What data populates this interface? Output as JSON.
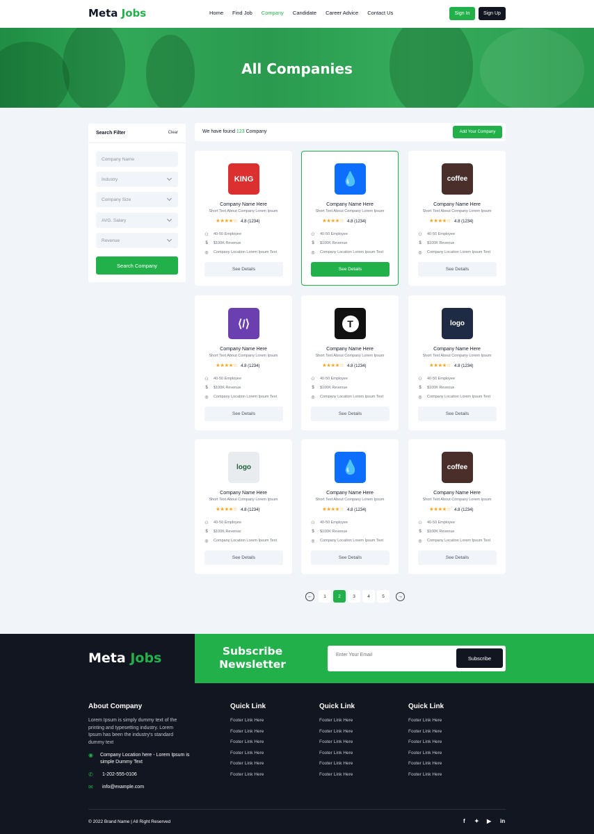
{
  "brand": {
    "part1": "Meta",
    "part2": "Jobs"
  },
  "nav": {
    "items": [
      "Home",
      "Find Job",
      "Company",
      "Candidate",
      "Career Advice",
      "Contact Us"
    ],
    "active": "Company",
    "sign_in": "Sign In",
    "sign_up": "Sign Up"
  },
  "hero": {
    "title": "All Companies"
  },
  "filter": {
    "title": "Search Filter",
    "clear": "Clear",
    "company_name_placeholder": "Company Name",
    "industry": "Industry",
    "company_size": "Company Size",
    "avg_salary": "AVG. Salary",
    "revenue": "Revenue",
    "search_button": "Search Company"
  },
  "results": {
    "prefix": "We have found",
    "count": "123",
    "suffix": "Company",
    "add_button": "Add Your Company"
  },
  "cards": [
    {
      "name": "Company Name Here",
      "short": "Short Text About Company Lorem Ipsum",
      "rating": "4.8 (1234)",
      "stars": 4,
      "employees": "40-50 Employee",
      "revenue": "$100K Revenue",
      "location": "Company Location Lorem Ipsum Text",
      "button": "See Details",
      "logo": "king-logo",
      "logo_text": "KING",
      "color": "#dc2f2f"
    },
    {
      "name": "Company Name Here",
      "short": "Short Text About Company Lorem Ipsum",
      "rating": "4.8 (1234)",
      "stars": 4,
      "employees": "40-50 Employee",
      "revenue": "$100K Revenue",
      "location": "Company Location Lorem Ipsum Text",
      "button": "See Details",
      "logo": "drop-logo",
      "logo_text": "",
      "color": "#0d6efd",
      "selected": true
    },
    {
      "name": "Company Name Here",
      "short": "Short Text About Company Lorem Ipsum",
      "rating": "4.8 (1234)",
      "stars": 4,
      "employees": "40-50 Employee",
      "revenue": "$100K Revenue",
      "location": "Company Location Lorem Ipsum Text",
      "button": "See Details",
      "logo": "coffee-logo",
      "logo_text": "coffee",
      "color": "#4a2e2a"
    },
    {
      "name": "Company Name Here",
      "short": "Short Text About Company Lorem Ipsum",
      "rating": "4.8 (1234)",
      "stars": 4,
      "employees": "40-50 Employee",
      "revenue": "$100K Revenue",
      "location": "Company Location Lorem Ipsum Text",
      "button": "See Details",
      "logo": "code-logo",
      "logo_text": "",
      "color": "#6b3fb0"
    },
    {
      "name": "Company Name Here",
      "short": "Short Text About Company Lorem Ipsum",
      "rating": "4.8 (1234)",
      "stars": 4,
      "employees": "40-50 Employee",
      "revenue": "$100K Revenue",
      "location": "Company Location Lorem Ipsum Text",
      "button": "See Details",
      "logo": "t-logo",
      "logo_text": "",
      "color": "#111111"
    },
    {
      "name": "Company Name Here",
      "short": "Short Text About Company Lorem Ipsum",
      "rating": "4.8 (1234)",
      "stars": 4,
      "employees": "40-50 Employee",
      "revenue": "$100K Revenue",
      "location": "Company Location Lorem Ipsum Text",
      "button": "See Details",
      "logo": "a-logo",
      "logo_text": "logo",
      "color": "#1f2a44"
    },
    {
      "name": "Company Name Here",
      "short": "Short Text About Company Lorem Ipsum",
      "rating": "4.8 (1234)",
      "stars": 4,
      "employees": "40-50 Employee",
      "revenue": "$100K Revenue",
      "location": "Company Location Lorem Ipsum Text",
      "button": "See Details",
      "logo": "diamond-logo",
      "logo_text": "logo",
      "color": "#e9ecef"
    },
    {
      "name": "Company Name Here",
      "short": "Short Text About Company Lorem Ipsum",
      "rating": "4.8 (1234)",
      "stars": 4,
      "employees": "40-50 Employee",
      "revenue": "$100K Revenue",
      "location": "Company Location Lorem Ipsum Text",
      "button": "See Details",
      "logo": "drop-logo",
      "logo_text": "",
      "color": "#0d6efd"
    },
    {
      "name": "Company Name Here",
      "short": "Short Text About Company Lorem Ipsum",
      "rating": "4.8 (1234)",
      "stars": 4,
      "employees": "40-50 Employee",
      "revenue": "$100K Revenue",
      "location": "Company Location Lorem Ipsum Text",
      "button": "See Details",
      "logo": "coffee-logo",
      "logo_text": "coffee",
      "color": "#4a2e2a"
    }
  ],
  "pagination": {
    "pages": [
      "1",
      "2",
      "3",
      "4",
      "5"
    ],
    "current": "2"
  },
  "newsletter": {
    "title_line1": "Subscribe",
    "title_line2": "Newsletter",
    "placeholder": "Enter Your Email",
    "button": "Subscribe"
  },
  "about": {
    "title": "About Company",
    "text": "Lorem Ipsum is simply dummy text of the printing and typesetting industry. Lorem Ipsum has been the industry's standard dummy text",
    "location": "Company Location here - Lorem Ipsum is simple Dummy Text",
    "phone": "1-202-555-0106",
    "email": "info@example.com"
  },
  "quick_links": [
    {
      "title": "Quick Link",
      "links": [
        "Footer Link Here",
        "Footer Link Here",
        "Footer Link Here",
        "Footer Link Here",
        "Footer Link Here",
        "Footer Link Here"
      ]
    },
    {
      "title": "Quick Link",
      "links": [
        "Footer Link Here",
        "Footer Link Here",
        "Footer Link Here",
        "Footer Link Here",
        "Footer Link Here",
        "Footer Link Here"
      ]
    },
    {
      "title": "Quick Link",
      "links": [
        "Footer Link Here",
        "Footer Link Here",
        "Footer Link Here",
        "Footer Link Here",
        "Footer Link Here",
        "Footer Link Here"
      ]
    }
  ],
  "copyright": "© 2022 Brand Name | All Right Reserved",
  "social": [
    "facebook-icon",
    "twitter-icon",
    "youtube-icon",
    "linkedin-icon"
  ],
  "colors": {
    "accent": "#22b04b",
    "dark": "#121620"
  }
}
